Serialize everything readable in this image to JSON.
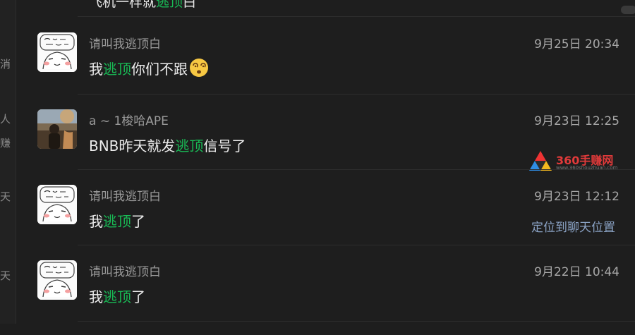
{
  "top_partial": {
    "before": "飞机一样就",
    "highlight": "逃顶",
    "after": "白"
  },
  "left_strip": [
    "消",
    "人",
    "赚",
    "天",
    "天"
  ],
  "messages": [
    {
      "name": "请叫我逃顶白",
      "time": "9月25日 20:34",
      "before": "我",
      "highlight": "逃顶",
      "after": "你们不跟",
      "emoji": "dizzy-face-emoji",
      "avatar": "cartoon-avatar"
    },
    {
      "name": "a ~ 1梭哈APE",
      "time": "9月23日 12:25",
      "before": "BNB昨天就发",
      "highlight": "逃顶",
      "after": "信号了",
      "avatar": "photo-avatar"
    },
    {
      "name": "请叫我逃顶白",
      "time": "9月23日 12:12",
      "before": "我",
      "highlight": "逃顶",
      "after": "了",
      "locate_label": "定位到聊天位置",
      "avatar": "cartoon-avatar"
    },
    {
      "name": "请叫我逃顶白",
      "time": "9月22日 10:44",
      "before": "我",
      "highlight": "逃顶",
      "after": "了",
      "avatar": "cartoon-avatar"
    }
  ],
  "watermark": {
    "text": "360手赚网",
    "subtext": "www.360shouzhuan.com"
  },
  "colors": {
    "highlight": "#19b955",
    "background": "#1e1e1e",
    "link": "#8aa2c4"
  }
}
